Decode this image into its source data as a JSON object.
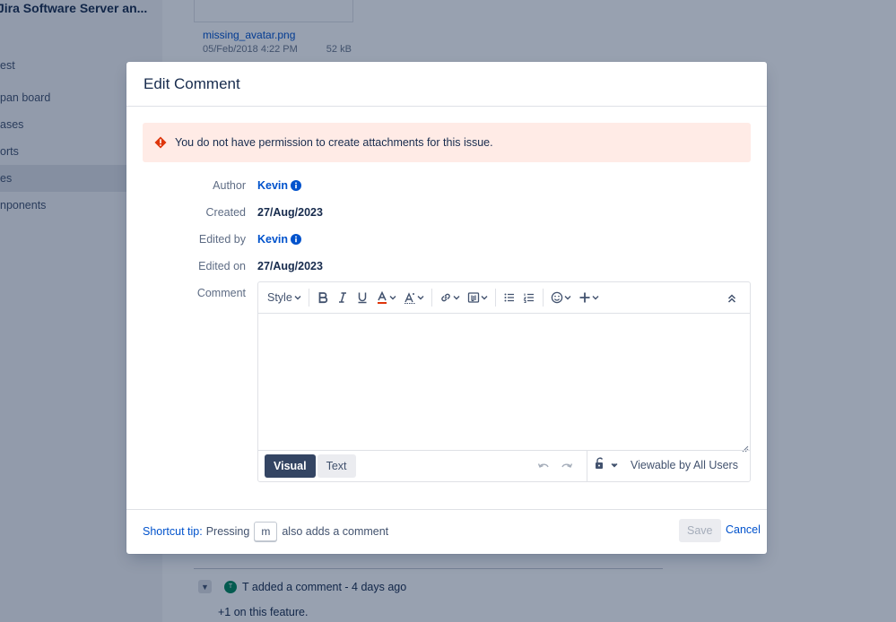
{
  "background": {
    "project_name": "Jira Software Server an...",
    "nav_items": [
      {
        "label": "est"
      },
      {
        "label": "pan board"
      },
      {
        "label": "ases"
      },
      {
        "label": "orts"
      },
      {
        "label": "es"
      },
      {
        "label": "nponents"
      }
    ],
    "attachment": {
      "file_name": "missing_avatar.png",
      "date": "05/Feb/2018 4:22 PM",
      "size": "52 kB"
    },
    "activity": {
      "avatar_initial": "T",
      "summary": "T added a comment - 4 days ago",
      "comment_text": "+1 on this feature."
    }
  },
  "dialog": {
    "title": "Edit Comment",
    "error_message": "You do not have permission to create attachments for this issue.",
    "fields": {
      "author_label": "Author",
      "author_value": "Kevin",
      "created_label": "Created",
      "created_value": "27/Aug/2023",
      "edited_by_label": "Edited by",
      "edited_by_value": "Kevin",
      "edited_on_label": "Edited on",
      "edited_on_value": "27/Aug/2023",
      "comment_label": "Comment"
    },
    "editor": {
      "style_label": "Style",
      "content": "",
      "mode_visual": "Visual",
      "mode_text": "Text",
      "visibility_label": "Viewable by All Users"
    },
    "footer": {
      "shortcut_tip_label": "Shortcut tip:",
      "shortcut_pressing": "Pressing",
      "shortcut_key": "m",
      "shortcut_suffix": "also adds a comment",
      "save_label": "Save",
      "cancel_label": "Cancel"
    }
  },
  "colors": {
    "link": "#0052cc",
    "error_bg": "#ffebe6",
    "error_icon": "#de350b",
    "active_tab": "#344563"
  }
}
